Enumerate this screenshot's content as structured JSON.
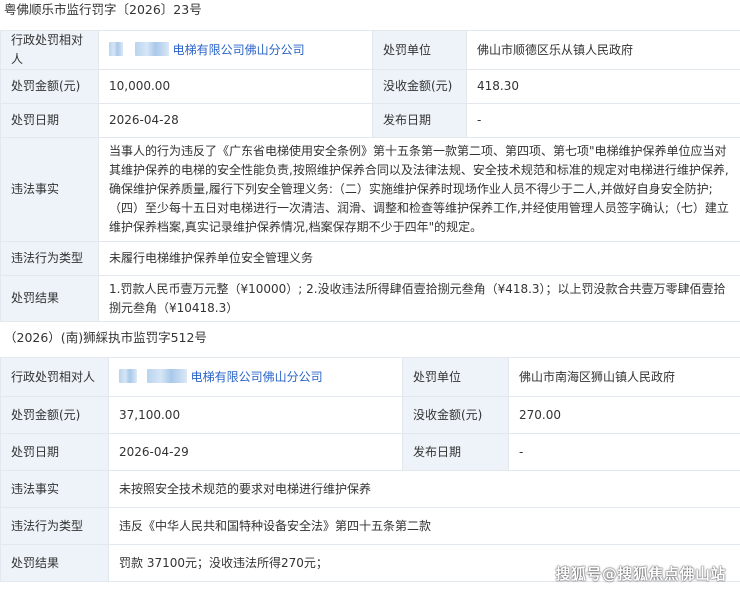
{
  "case1": {
    "title": "粤佛顺乐市监行罚字〔2026〕23号",
    "party_label": "行政处罚相对人",
    "party_value": "电梯有限公司佛山分公司",
    "authority_label": "处罚单位",
    "authority_value": "佛山市顺德区乐从镇人民政府",
    "fine_label": "处罚金额(元)",
    "fine_value": "10,000.00",
    "confiscated_label": "没收金额(元)",
    "confiscated_value": "418.30",
    "date_label": "处罚日期",
    "date_value": "2026-04-28",
    "publish_label": "发布日期",
    "publish_value": "-",
    "facts_label": "违法事实",
    "facts_value": "当事人的行为违反了《广东省电梯使用安全条例》第十五条第一款第二项、第四项、第七项\"电梯维护保养单位应当对其维护保养的电梯的安全性能负责,按照维护保养合同以及法律法规、安全技术规范和标准的规定对电梯进行维护保养,确保维护保养质量,履行下列安全管理义务:（二）实施维护保养时现场作业人员不得少于二人,并做好自身安全防护;（四）至少每十五日对电梯进行一次清洁、润滑、调整和检查等维护保养工作,并经使用管理人员签字确认;（七）建立维护保养档案,真实记录维护保养情况,档案保存期不少于四年\"的规定。",
    "type_label": "违法行为类型",
    "type_value": "未履行电梯维护保养单位安全管理义务",
    "result_label": "处罚结果",
    "result_value": "1.罚款人民币壹万元整（¥10000）; 2.没收违法所得肆佰壹拾捌元叁角（¥418.3）；以上罚没款合共壹万零肆佰壹拾捌元叁角（¥10418.3）"
  },
  "case2": {
    "title": "（2026）(南)狮綵执市监罚字512号",
    "party_label": "行政处罚相对人",
    "party_value": "电梯有限公司佛山分公司",
    "authority_label": "处罚单位",
    "authority_value": "佛山市南海区狮山镇人民政府",
    "fine_label": "处罚金额(元)",
    "fine_value": "37,100.00",
    "confiscated_label": "没收金额(元)",
    "confiscated_value": "270.00",
    "date_label": "处罚日期",
    "date_value": "2026-04-29",
    "publish_label": "发布日期",
    "publish_value": "-",
    "facts_label": "违法事实",
    "facts_value": "未按照安全技术规范的要求对电梯进行维护保养",
    "type_label": "违法行为类型",
    "type_value": "违反《中华人民共和国特种设备安全法》第四十五条第二款",
    "result_label": "处罚结果",
    "result_value": "罚款 37100元；没收违法所得270元；"
  },
  "watermark": "搜狐号@搜狐焦点佛山站",
  "colors": {
    "label_bg": "#eef3f9",
    "border": "#e3e8ef",
    "link": "#2a64c8"
  }
}
